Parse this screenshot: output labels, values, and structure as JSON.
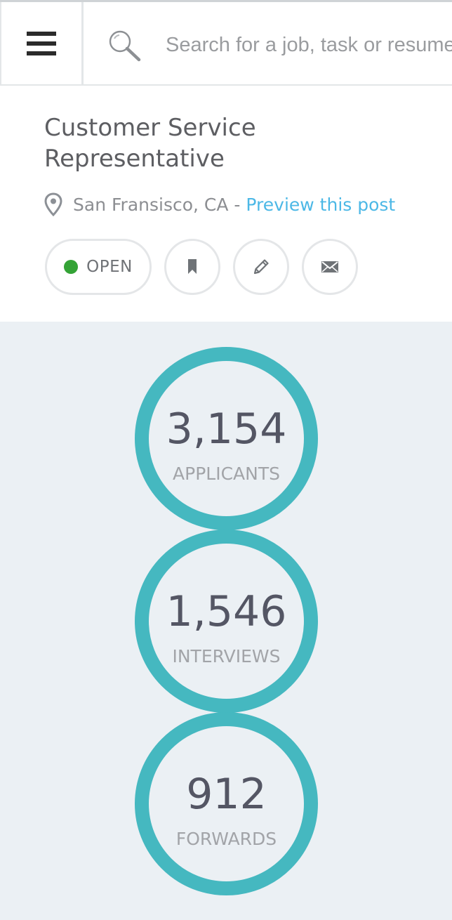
{
  "header": {
    "search": {
      "placeholder": "Search for a job, task or resume",
      "value": ""
    }
  },
  "job": {
    "title": "Customer Service Representative",
    "location": "San Fransisco, CA",
    "separator": " - ",
    "preview_label": "Preview this post",
    "status": {
      "label": "OPEN",
      "color": "#34a336"
    }
  },
  "stats": [
    {
      "value": "3,154",
      "label": "APPLICANTS"
    },
    {
      "value": "1,546",
      "label": "INTERVIEWS"
    },
    {
      "value": "912",
      "label": "FORWARDS"
    }
  ],
  "colors": {
    "accent": "#45b8c0",
    "link": "#4cb8e6",
    "stats_background": "#ebf0f4"
  },
  "icons": [
    "menu-icon",
    "search-icon",
    "location-pin-icon",
    "bookmark-icon",
    "pencil-icon",
    "envelope-icon"
  ]
}
